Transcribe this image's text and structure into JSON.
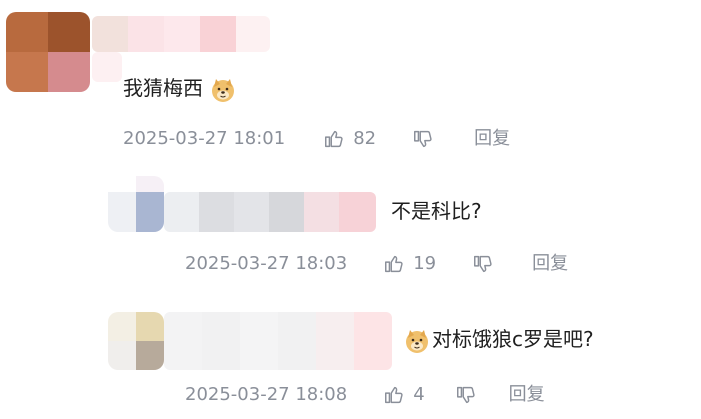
{
  "comments": [
    {
      "text": "我猜梅西",
      "timestamp": "2025-03-27 18:01",
      "likes": "82",
      "reply_label": "回复",
      "trailing_emoji": "doge-emoji"
    },
    {
      "text": "不是科比?",
      "timestamp": "2025-03-27 18:03",
      "likes": "19",
      "reply_label": "回复"
    },
    {
      "text": "对标饿狼c罗是吧?",
      "timestamp": "2025-03-27 18:08",
      "likes": "4",
      "reply_label": "回复",
      "leading_emoji": "doge-emoji"
    }
  ],
  "icons": {
    "like": "thumbs-up-icon",
    "dislike": "thumbs-down-icon"
  },
  "colors": {
    "meta_text": "#8a8f99",
    "body_text": "#1f1f1f"
  }
}
